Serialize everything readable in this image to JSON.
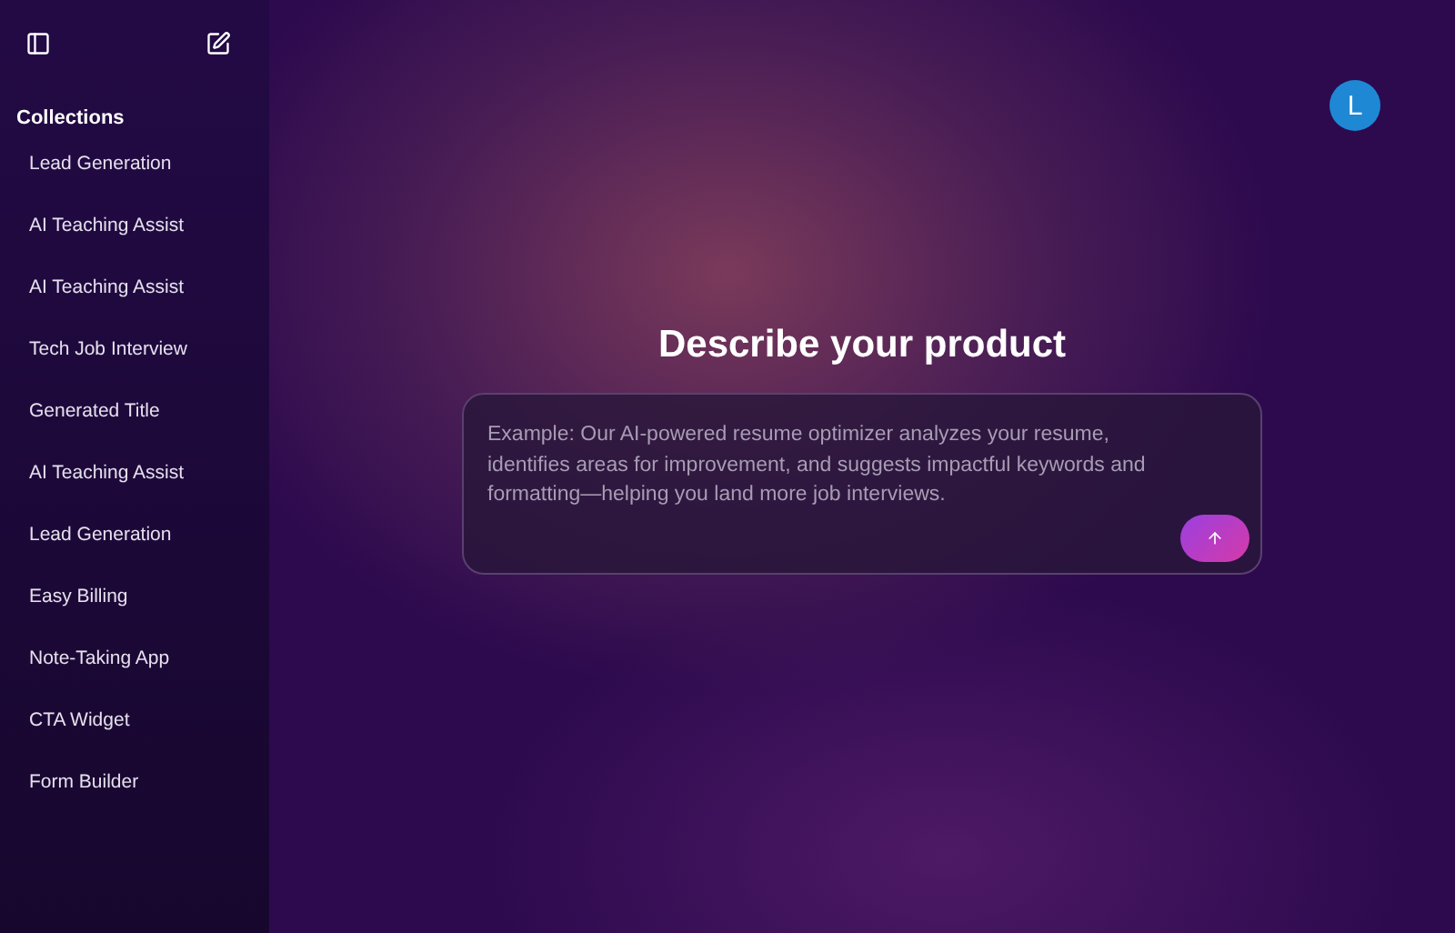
{
  "sidebar": {
    "heading": "Collections",
    "items": [
      {
        "label": "Lead Generation"
      },
      {
        "label": "AI Teaching Assist"
      },
      {
        "label": "AI Teaching Assist"
      },
      {
        "label": "Tech Job Interview"
      },
      {
        "label": "Generated Title"
      },
      {
        "label": "AI Teaching Assist"
      },
      {
        "label": "Lead Generation"
      },
      {
        "label": "Easy Billing"
      },
      {
        "label": "Note-Taking App"
      },
      {
        "label": "CTA Widget"
      },
      {
        "label": "Form Builder"
      }
    ]
  },
  "avatar": {
    "initial": "L"
  },
  "main": {
    "title": "Describe your product",
    "prompt": {
      "placeholder": "Example: Our AI-powered resume optimizer analyzes your resume, identifies areas for improvement, and suggests impactful keywords and formatting—helping you land more job interviews."
    }
  }
}
